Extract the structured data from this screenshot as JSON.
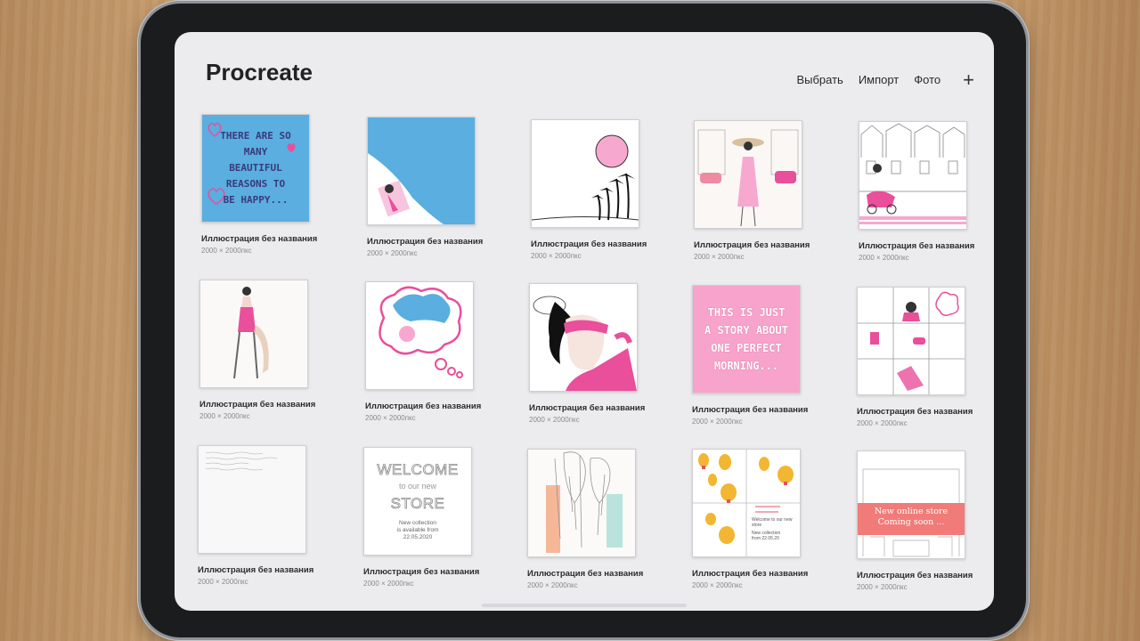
{
  "app": {
    "title": "Procreate"
  },
  "toolbar": {
    "select_label": "Выбрать",
    "import_label": "Импорт",
    "photo_label": "Фото",
    "add_label": "+"
  },
  "gallery": {
    "items": [
      {
        "name": "Иллюстрация без названия",
        "size": "2000 × 2000пкс",
        "text": "THERE ARE SO MANY BEAUTIFUL REASONS TO BE HAPPY..."
      },
      {
        "name": "Иллюстрация без названия",
        "size": "2000 × 2000пкс"
      },
      {
        "name": "Иллюстрация без названия",
        "size": "2000 × 2000пкс"
      },
      {
        "name": "Иллюстрация без названия",
        "size": "2000 × 2000пкс"
      },
      {
        "name": "Иллюстрация без названия",
        "size": "2000 × 2000пкс"
      },
      {
        "name": "Иллюстрация без названия",
        "size": "2000 × 2000пкс"
      },
      {
        "name": "Иллюстрация без названия",
        "size": "2000 × 2000пкс"
      },
      {
        "name": "Иллюстрация без названия",
        "size": "2000 × 2000пкс"
      },
      {
        "name": "Иллюстрация без названия",
        "size": "2000 × 2000пкс",
        "text": "THIS IS JUST A STORY ABOUT ONE PERFECT MORNING..."
      },
      {
        "name": "Иллюстрация без названия",
        "size": "2000 × 2000пкс"
      },
      {
        "name": "Иллюстрация без названия",
        "size": "2000 × 2000пкс"
      },
      {
        "name": "Иллюстрация без названия",
        "size": "2000 × 2000пкс",
        "line1": "WELCOME",
        "line2": "to our new",
        "line3": "STORE",
        "line4": "New collection",
        "line5": "is available from",
        "line6": "22.05.2020"
      },
      {
        "name": "Иллюстрация без названия",
        "size": "2000 × 2000пкс"
      },
      {
        "name": "Иллюстрация без названия",
        "size": "2000 × 2000пкс",
        "line1": "Welcome to our new store",
        "line2": "New collection",
        "line3": "from 22.05.20"
      },
      {
        "name": "Иллюстрация без названия",
        "size": "2000 × 2000пкс",
        "line1": "New online store",
        "line2": "Coming soon ..."
      }
    ]
  },
  "colors": {
    "accent_blue": "#5aaee0",
    "accent_pink": "#e94f9a",
    "light_pink": "#f7a8cf",
    "coral": "#f07b78",
    "screen_bg": "#ececee"
  }
}
